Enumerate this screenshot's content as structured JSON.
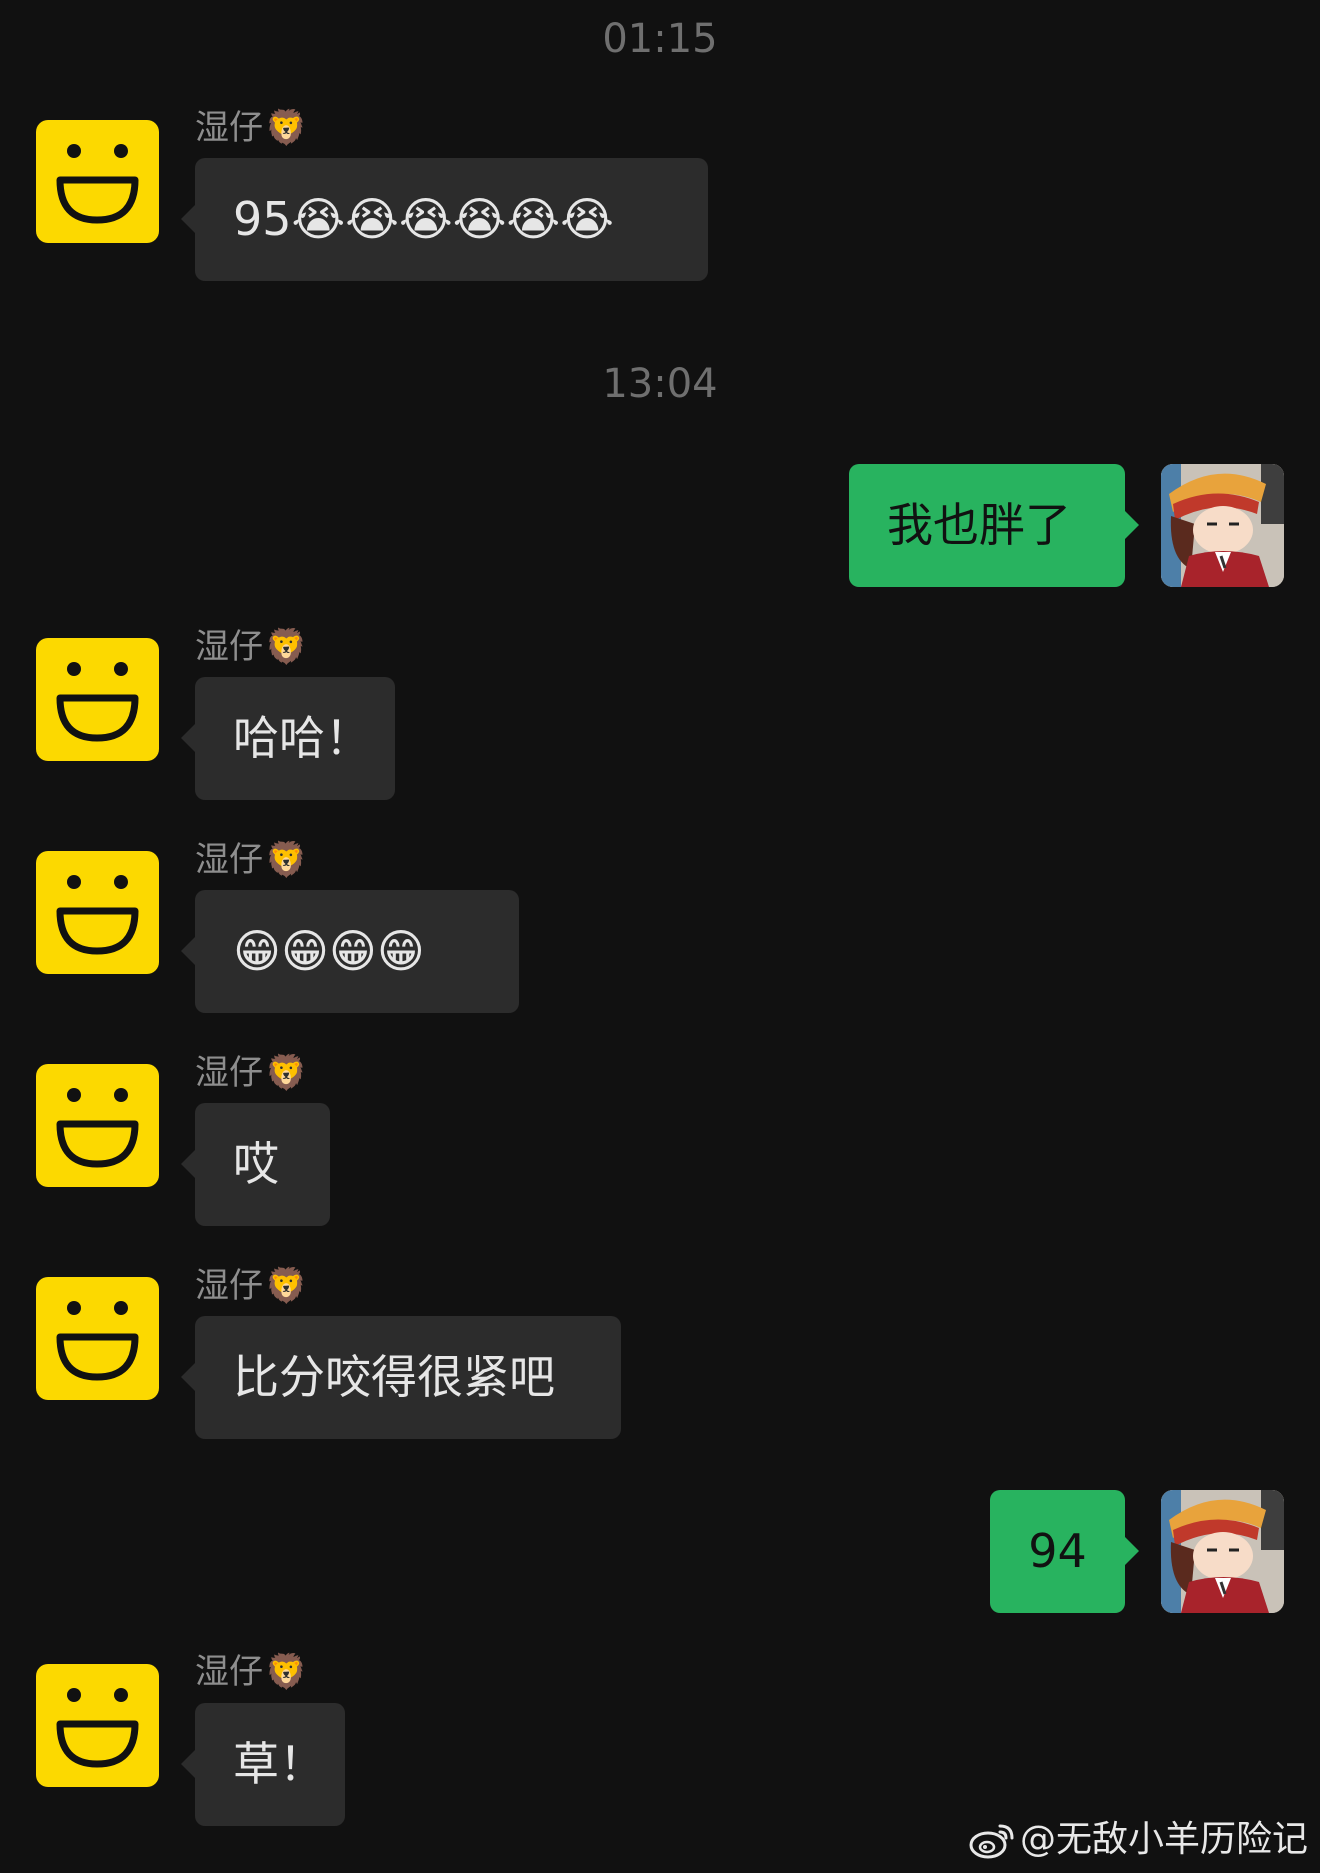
{
  "timestamps": [
    "01:15",
    "13:04"
  ],
  "sender_name": "湿仔",
  "sender_badge": "🦁",
  "messages": [
    {
      "direction": "in",
      "text": "95😭😭😭😭😭😭"
    },
    {
      "direction": "out",
      "text": "我也胖了"
    },
    {
      "direction": "in",
      "text": "哈哈！"
    },
    {
      "direction": "in",
      "text": "😁😁😁😁"
    },
    {
      "direction": "in",
      "text": "哎"
    },
    {
      "direction": "in",
      "text": "比分咬得很紧吧"
    },
    {
      "direction": "out",
      "text": "94"
    },
    {
      "direction": "in",
      "text": "草！"
    }
  ],
  "watermark": {
    "icon": "weibo-icon",
    "text": "@无敌小羊历险记"
  },
  "colors": {
    "background": "#111111",
    "incoming_bubble": "#2c2c2c",
    "outgoing_bubble": "#28b35f",
    "avatar_yellow": "#fcd900"
  }
}
